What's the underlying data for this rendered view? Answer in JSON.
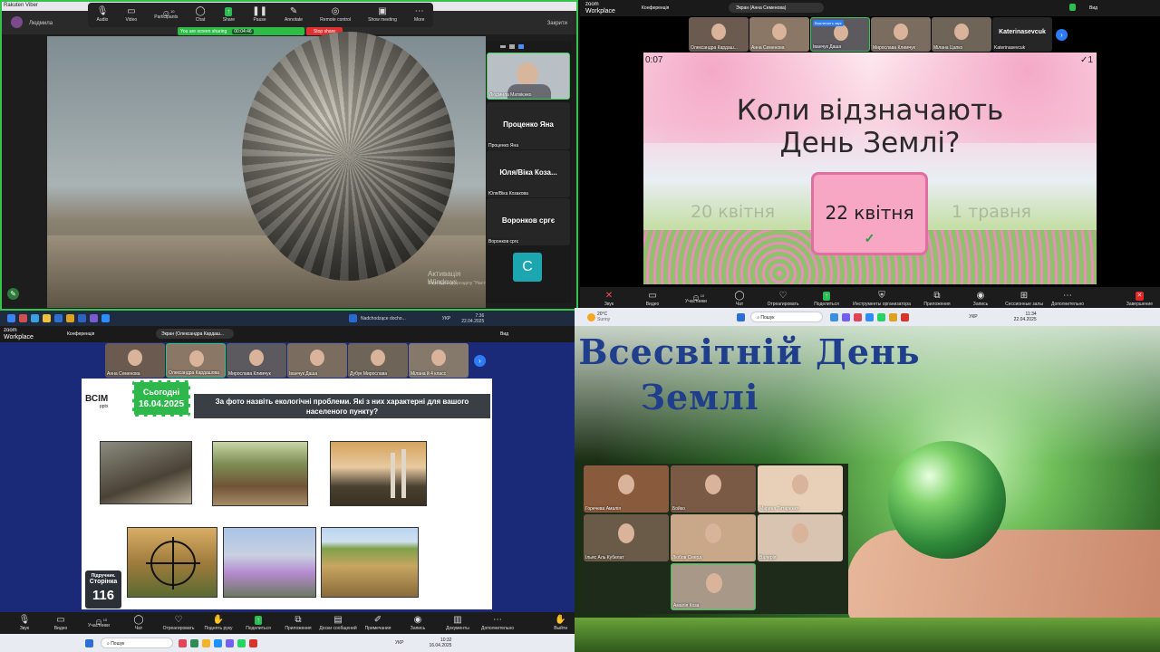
{
  "q1": {
    "window_title": "Rakuten Viber",
    "close_label": "Закрити",
    "user_name": "Людмила",
    "toolbar": [
      {
        "label": "Audio",
        "icon": "mic-icon"
      },
      {
        "label": "Video",
        "icon": "video-icon"
      },
      {
        "label": "Participants",
        "icon": "participants-icon",
        "count": "10"
      },
      {
        "label": "Chat",
        "icon": "chat-icon"
      },
      {
        "label": "Share",
        "icon": "share-icon"
      },
      {
        "label": "Pause",
        "icon": "pause-icon"
      },
      {
        "label": "Annotate",
        "icon": "pen-icon"
      },
      {
        "label": "Remote control",
        "icon": "remote-icon"
      },
      {
        "label": "Show meeting",
        "icon": "monitor-icon"
      },
      {
        "label": "More",
        "icon": "more-icon"
      }
    ],
    "sharing_status": "You are screen sharing",
    "sharing_timer": "00:04:46",
    "stop_share": "Stop share",
    "side_tiles": [
      {
        "display": "",
        "name": "Людмила Матвієнко"
      },
      {
        "display": "Проценко Яна",
        "name": "Проценко Яна"
      },
      {
        "display": "Юля/Віка Коза...",
        "name": "Юля/Віка Козакова"
      },
      {
        "display": "Воронков сргє",
        "name": "Воронков сргє"
      }
    ],
    "avatar_letter": "C",
    "activation_title": "Активація Windows",
    "activation_text": "Перейдіть до розділу \"Настройки\", щоб активувати Windows."
  },
  "q1_taskbar": {
    "time": "7:36",
    "date": "22.04.2025",
    "lang": "УКР",
    "news": "Nadchodzące docho..."
  },
  "q2": {
    "brand_line1": "zoom",
    "brand_line2": "Workplace",
    "conference": "Конференція",
    "screen_tab": "Экран (Анна Семенова)",
    "view": "Вид",
    "tiles": [
      {
        "name": "Олександра Кардаш..."
      },
      {
        "name": "Анна Семенова"
      },
      {
        "name": "Іванчук Даша",
        "badge": "Выключить звук"
      },
      {
        "name": "Мирослава Климчук"
      },
      {
        "name": "Мілана Цапко"
      },
      {
        "name": "Katerinasevcuk",
        "display": "Katerinasevcuk"
      }
    ],
    "quiz": {
      "timer": "0:07",
      "score": "1",
      "question_line1": "Коли відзначають",
      "question_line2": "День Землі?",
      "answers": [
        "20 квітня",
        "22 квітня",
        "1 травня"
      ],
      "check": "✓"
    },
    "toolbar": [
      {
        "label": "Звук",
        "icon": "mic-off-icon"
      },
      {
        "label": "Видео",
        "icon": "video-icon"
      },
      {
        "label": "Участники",
        "icon": "participants-icon",
        "count": "10"
      },
      {
        "label": "Чат",
        "icon": "chat-icon"
      },
      {
        "label": "Отреагировать",
        "icon": "heart-icon"
      },
      {
        "label": "Поделиться",
        "icon": "share-icon"
      },
      {
        "label": "Инструменты организатора",
        "icon": "shield-icon"
      },
      {
        "label": "Приложения",
        "icon": "apps-icon"
      },
      {
        "label": "Запись",
        "icon": "record-icon"
      },
      {
        "label": "Сессионные залы",
        "icon": "grid-icon"
      },
      {
        "label": "Дополнительно",
        "icon": "more-icon"
      }
    ],
    "end_label": "Завершение"
  },
  "q3": {
    "brand_line1": "zoom",
    "brand_line2": "Workplace",
    "conference": "Конференція",
    "screen_tab": "Экран (Олександра Кардаш...",
    "view": "Вид",
    "tiles": [
      {
        "name": "Анна Семенова"
      },
      {
        "name": "Олександра Кардашова"
      },
      {
        "name": "Мирослава Климчук"
      },
      {
        "name": "Іванчук Даша"
      },
      {
        "name": "Дубук Мирослава"
      },
      {
        "name": "Мілана й 4 класс"
      }
    ],
    "slide": {
      "logo": "ВСІМ",
      "logo_sub": "pptx",
      "today_label": "Сьогодні",
      "today_date": "16.04.2025",
      "question": "За фото назвіть екологічні проблеми. Які з них характерні для вашого населеного пункту?",
      "page_label_1": "Підручник.",
      "page_label_2": "Сторінка",
      "page_number": "116"
    },
    "toolbar": [
      {
        "label": "Звук",
        "icon": "mic-icon"
      },
      {
        "label": "Видео",
        "icon": "video-icon"
      },
      {
        "label": "Участники",
        "icon": "participants-icon",
        "count": "10"
      },
      {
        "label": "Чат",
        "icon": "chat-icon"
      },
      {
        "label": "Отреагировать",
        "icon": "heart-icon"
      },
      {
        "label": "Поднять руку",
        "icon": "hand-icon"
      },
      {
        "label": "Поделиться",
        "icon": "share-icon"
      },
      {
        "label": "Приложения",
        "icon": "apps-icon"
      },
      {
        "label": "Доски сообщений",
        "icon": "board-icon"
      },
      {
        "label": "Примечания",
        "icon": "notes-icon"
      },
      {
        "label": "Запись",
        "icon": "record-icon"
      },
      {
        "label": "Документы",
        "icon": "docs-icon"
      },
      {
        "label": "Дополнительно",
        "icon": "more-icon"
      }
    ],
    "exit_label": "Выйти"
  },
  "q3_taskbar": {
    "search": "Пошук",
    "lang": "УКР",
    "time": "10:32",
    "date": "16.04.2025"
  },
  "q4": {
    "weather_temp": "20°C",
    "weather_desc": "Sunny",
    "search": "Пошук",
    "lang": "УКР",
    "time": "11:34",
    "date": "22.04.2025",
    "title_line1": "Всесвітній День",
    "title_line2": "Землі",
    "tiles": [
      {
        "name": "Горечева Амалія"
      },
      {
        "name": "Бойко"
      },
      {
        "name": "Марина Титаренко"
      },
      {
        "name": "Ільяс Аль Кубелат"
      },
      {
        "name": "Любов Смерд"
      },
      {
        "name": "Валерія"
      },
      {
        "name": "Амалія Коза"
      }
    ]
  }
}
